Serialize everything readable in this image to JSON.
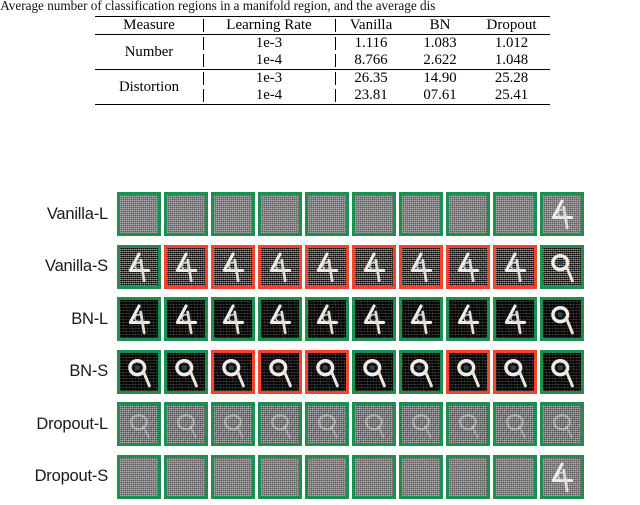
{
  "caption": ": Average number of classification regions in a manifold region, and the average dis",
  "table": {
    "headers": [
      "Measure",
      "Learning Rate",
      "Vanilla",
      "BN",
      "Dropout"
    ],
    "groups": [
      {
        "measure": "Number",
        "rows": [
          {
            "lr": "1e-3",
            "vanilla": "1.116",
            "bn": "1.083",
            "dropout": "1.012"
          },
          {
            "lr": "1e-4",
            "vanilla": "8.766",
            "bn": "2.622",
            "dropout": "1.048"
          }
        ]
      },
      {
        "measure": "Distortion",
        "rows": [
          {
            "lr": "1e-3",
            "vanilla": "26.35",
            "bn": "14.90",
            "dropout": "25.28"
          },
          {
            "lr": "1e-4",
            "vanilla": "23.81",
            "bn": "07.61",
            "dropout": "25.41"
          }
        ]
      }
    ]
  },
  "figure": {
    "colors": {
      "correct_border": "#1b8f4d",
      "incorrect_border": "#f4422b"
    },
    "columns": 10,
    "rows": [
      {
        "label": "Vanilla-L",
        "texture": "tex-gray-soft",
        "digits": [
          "none",
          "none",
          "none",
          "none",
          "none",
          "none",
          "none",
          "none",
          "none",
          "four"
        ],
        "borders": [
          "green",
          "green",
          "green",
          "green",
          "green",
          "green",
          "green",
          "green",
          "green",
          "green"
        ]
      },
      {
        "label": "Vanilla-S",
        "texture": "tex-noisy-dark",
        "digits": [
          "four",
          "four",
          "four",
          "four",
          "four",
          "four",
          "four",
          "four",
          "four",
          "nine"
        ],
        "borders": [
          "green",
          "red",
          "red",
          "red",
          "red",
          "red",
          "red",
          "red",
          "red",
          "green"
        ]
      },
      {
        "label": "BN-L",
        "texture": "tex-dark",
        "digits": [
          "four",
          "four",
          "four",
          "four",
          "four",
          "four",
          "four",
          "four",
          "four",
          "nine"
        ],
        "borders": [
          "green",
          "green",
          "green",
          "green",
          "green",
          "green",
          "green",
          "green",
          "green",
          "green"
        ]
      },
      {
        "label": "BN-S",
        "texture": "tex-dark",
        "digits": [
          "nine",
          "nine",
          "nine",
          "nine",
          "nine",
          "nine",
          "nine",
          "nine",
          "nine",
          "nine"
        ],
        "borders": [
          "green",
          "green",
          "red",
          "red",
          "red",
          "green",
          "green",
          "red",
          "red",
          "green"
        ]
      },
      {
        "label": "Dropout-L",
        "texture": "tex-gray-mid",
        "digits": [
          "faint",
          "faint",
          "faint",
          "faint",
          "faint",
          "faint",
          "faint",
          "faint",
          "faint",
          "faint"
        ],
        "borders": [
          "green",
          "green",
          "green",
          "green",
          "green",
          "green",
          "green",
          "green",
          "green",
          "green"
        ]
      },
      {
        "label": "Dropout-S",
        "texture": "tex-gray-soft",
        "digits": [
          "none",
          "none",
          "none",
          "none",
          "none",
          "none",
          "none",
          "none",
          "none",
          "four"
        ],
        "borders": [
          "green",
          "green",
          "green",
          "green",
          "green",
          "green",
          "green",
          "green",
          "green",
          "green"
        ]
      }
    ]
  }
}
